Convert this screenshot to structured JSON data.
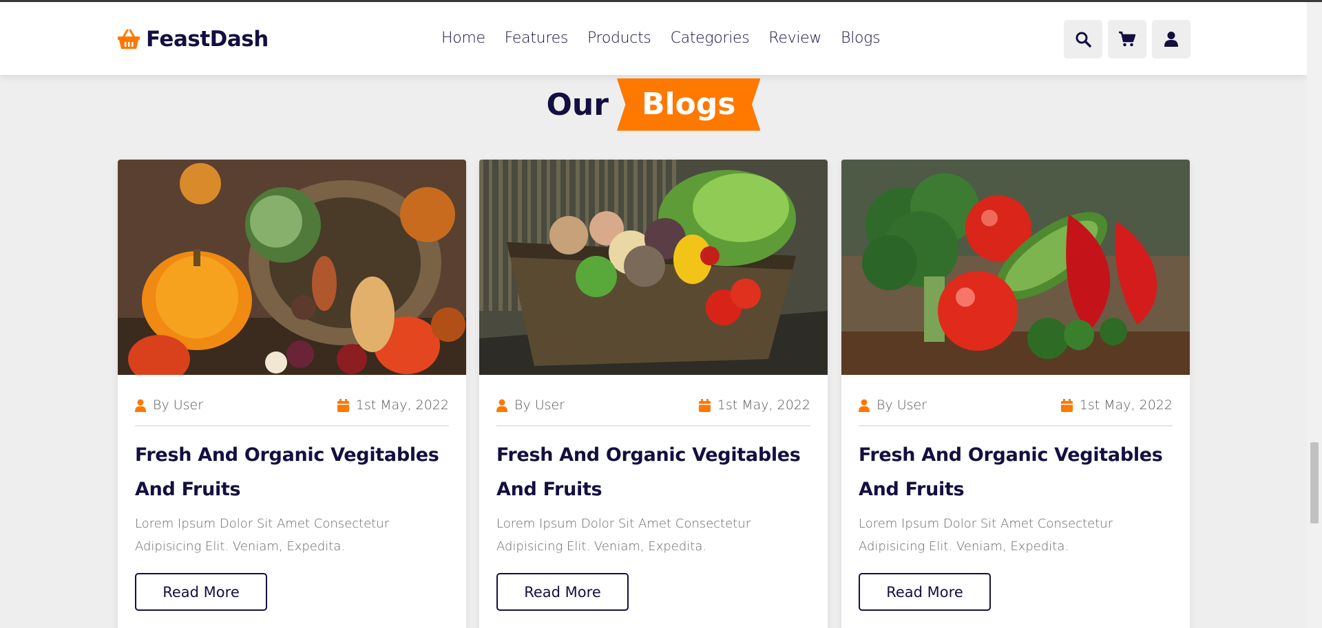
{
  "brand": {
    "name": "FeastDash",
    "icon": "basket-icon",
    "accent": "#ff7800",
    "ink": "#130f40"
  },
  "nav": {
    "items": [
      "Home",
      "Features",
      "Products",
      "Categories",
      "Review",
      "Blogs"
    ]
  },
  "header_icons": [
    "search-icon",
    "cart-icon",
    "user-icon"
  ],
  "section": {
    "title_plain": "Our",
    "title_badge": "Blogs"
  },
  "cards": [
    {
      "author": "By User",
      "date": "1st May, 2022",
      "title": "Fresh And Organic Vegitables And Fruits",
      "text": "Lorem Ipsum Dolor Sit Amet Consectetur Adipisicing Elit. Veniam, Expedita.",
      "button": "Read More"
    },
    {
      "author": "By User",
      "date": "1st May, 2022",
      "title": "Fresh And Organic Vegitables And Fruits",
      "text": "Lorem Ipsum Dolor Sit Amet Consectetur Adipisicing Elit. Veniam, Expedita.",
      "button": "Read More"
    },
    {
      "author": "By User",
      "date": "1st May, 2022",
      "title": "Fresh And Organic Vegitables And Fruits",
      "text": "Lorem Ipsum Dolor Sit Amet Consectetur Adipisicing Elit. Veniam, Expedita.",
      "button": "Read More"
    }
  ]
}
